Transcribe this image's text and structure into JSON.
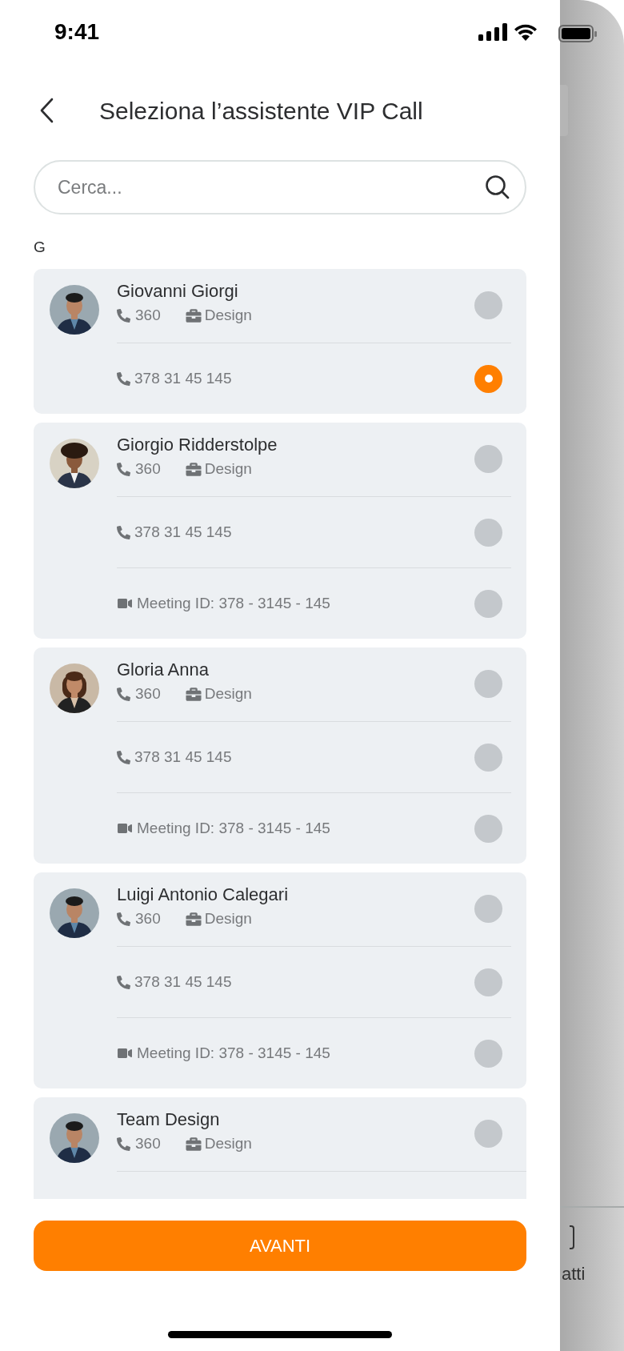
{
  "status_bar": {
    "time": "9:41"
  },
  "header": {
    "title": "Seleziona l’assistente VIP Call"
  },
  "search": {
    "placeholder": "Cerca..."
  },
  "section_letter": "G",
  "contacts": [
    {
      "name": "Giovanni Giorgi",
      "extension": "360",
      "department": "Design",
      "avatar": {
        "kind": "picture"
      },
      "selected": false,
      "options": [
        {
          "kind": "phone",
          "text": "378 31 45 145",
          "selected": true
        }
      ]
    },
    {
      "name": "Giorgio Ridderstolpe",
      "extension": "360",
      "department": "Design",
      "avatar": {
        "kind": "picture"
      },
      "selected": false,
      "options": [
        {
          "kind": "phone",
          "text": "378 31 45 145",
          "selected": false
        },
        {
          "kind": "meeting",
          "text": "Meeting ID: 378 - 3145 - 145",
          "selected": false
        }
      ]
    },
    {
      "name": "Gloria Anna",
      "extension": "360",
      "department": "Design",
      "avatar": {
        "kind": "picture"
      },
      "selected": false,
      "options": [
        {
          "kind": "phone",
          "text": "378 31 45 145",
          "selected": false
        },
        {
          "kind": "meeting",
          "text": "Meeting ID: 378 - 3145 - 145",
          "selected": false
        }
      ]
    },
    {
      "name": "Luigi Antonio Calegari",
      "extension": "360",
      "department": "Design",
      "avatar": {
        "kind": "picture"
      },
      "selected": false,
      "options": [
        {
          "kind": "phone",
          "text": "378 31 45 145",
          "selected": false
        },
        {
          "kind": "meeting",
          "text": "Meeting ID: 378 - 3145 - 145",
          "selected": false
        }
      ]
    },
    {
      "name": "Team Design",
      "extension": "360",
      "department": "Design",
      "avatar": {
        "kind": "picture"
      },
      "selected": false
    }
  ],
  "primary_button": {
    "label": "AVANTI"
  },
  "background_screen": {
    "tab_label": "atti"
  }
}
